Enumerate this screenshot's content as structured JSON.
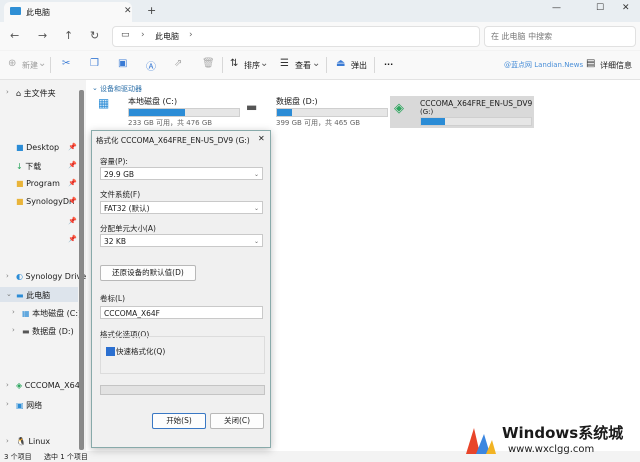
{
  "window": {
    "tab_title": "此电脑",
    "new_tab": "+",
    "minimize": "—",
    "maximize": "☐",
    "close": "✕"
  },
  "address": {
    "path_item": "此电脑",
    "search_placeholder": "在 此电脑 中搜索"
  },
  "toolbar": {
    "new": "新建",
    "sort": "排序",
    "view": "查看",
    "eject": "弹出",
    "more": "···",
    "details": "详细信息",
    "watermark_text": "@蓝点网 Landian.News"
  },
  "leftnav": {
    "home": "主文件夹",
    "desktop": "Desktop",
    "downloads": "下载",
    "program": "Program",
    "synologydri": "SynologyDri",
    "synology_drive": "Synology Drive",
    "this_pc": "此电脑",
    "local_c": "本地磁盘 (C:)",
    "data_d": "数据盘 (D:)",
    "cccoma": "CCCOMA_X64F",
    "network": "网络",
    "linux": "Linux"
  },
  "content": {
    "section": "设备和驱动器",
    "drives": [
      {
        "name": "本地磁盘 (C:)",
        "detail": "233 GB 可用，共 476 GB",
        "used_fraction": 0.51
      },
      {
        "name": "数据盘 (D:)",
        "detail": "399 GB 可用，共 465 GB",
        "used_fraction": 0.14
      },
      {
        "name": "CCCOMA_X64FRE_EN-US_DV9",
        "detail": "(G:)",
        "used_fraction": 0.22
      }
    ]
  },
  "status": {
    "count": "3 个项目",
    "selected": "选中 1 个项目"
  },
  "dialog": {
    "title": "格式化 CCCOMA_X64FRE_EN-US_DV9 (G:)",
    "close": "✕",
    "capacity_label": "容量(P):",
    "capacity_value": "29.9 GB",
    "fs_label": "文件系统(F)",
    "fs_value": "FAT32 (默认)",
    "alloc_label": "分配单元大小(A)",
    "alloc_value": "32 KB",
    "restore_btn": "还原设备的默认值(D)",
    "volume_label": "卷标(L)",
    "volume_value": "CCCOMA_X64F",
    "options_label": "格式化选项(O)",
    "quick_format": "快速格式化(Q)",
    "start_btn": "开始(S)",
    "close_btn": "关闭(C)"
  },
  "brand": {
    "name": "Windows系统城",
    "url": "www.wxclgg.com"
  },
  "colors": {
    "accent": "#2b8cd6",
    "selection": "#dde4ec"
  }
}
